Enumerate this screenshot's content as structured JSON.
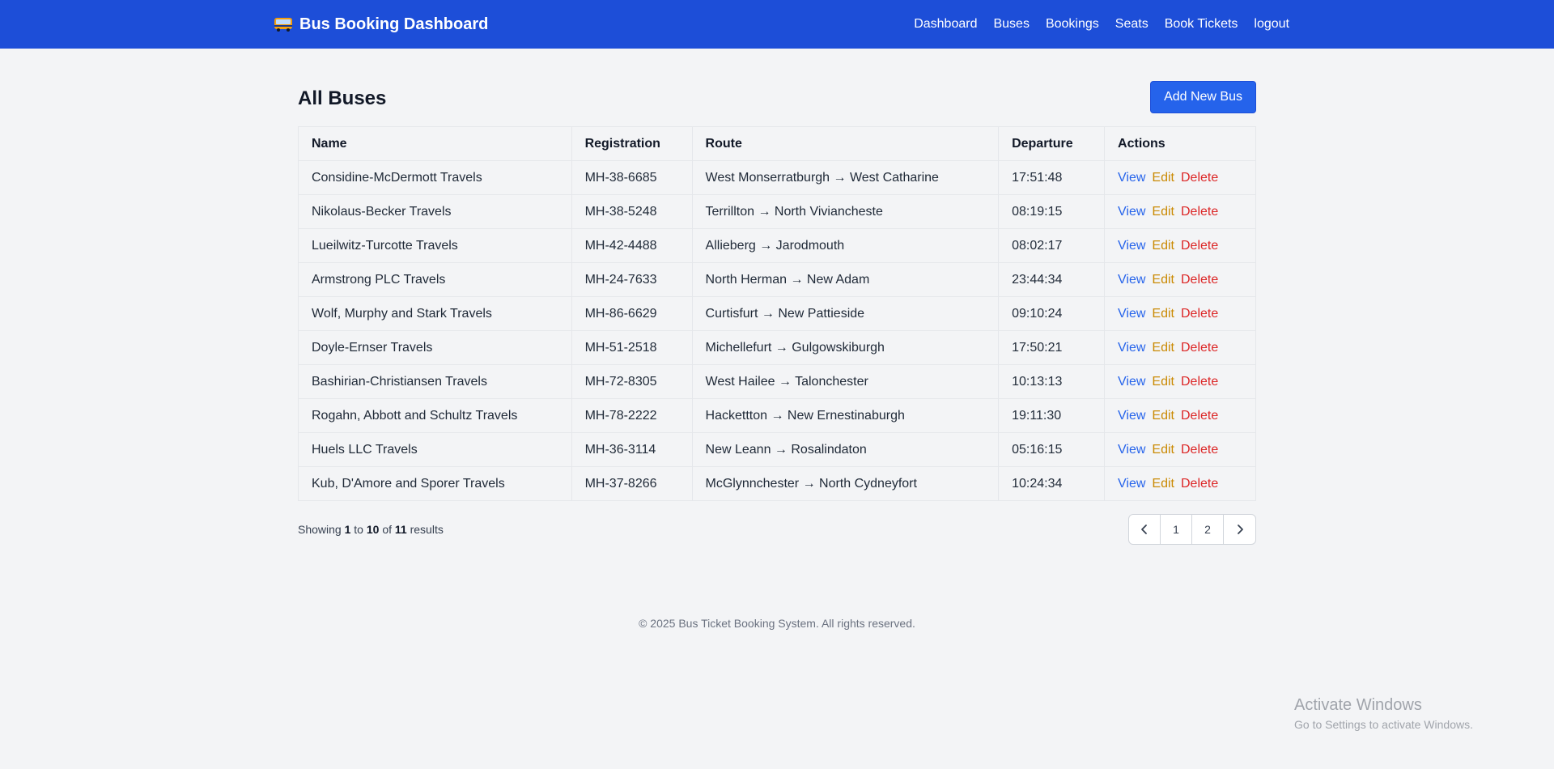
{
  "navbar": {
    "title": "Bus Booking Dashboard",
    "brand_icon": "bus-icon",
    "links": [
      "Dashboard",
      "Buses",
      "Bookings",
      "Seats",
      "Book Tickets",
      "logout"
    ]
  },
  "page": {
    "title": "All Buses",
    "add_button": "Add New Bus"
  },
  "table": {
    "headers": [
      "Name",
      "Registration",
      "Route",
      "Departure",
      "Actions"
    ],
    "rows": [
      {
        "name": "Considine-McDermott Travels",
        "registration": "MH-38-6685",
        "route": "West Monserratburgh → West Catharine",
        "departure": "17:51:48"
      },
      {
        "name": "Nikolaus-Becker Travels",
        "registration": "MH-38-5248",
        "route": "Terrillton → North Viviancheste",
        "departure": "08:19:15"
      },
      {
        "name": "Lueilwitz-Turcotte Travels",
        "registration": "MH-42-4488",
        "route": "Allieberg → Jarodmouth",
        "departure": "08:02:17"
      },
      {
        "name": "Armstrong PLC Travels",
        "registration": "MH-24-7633",
        "route": "North Herman → New Adam",
        "departure": "23:44:34"
      },
      {
        "name": "Wolf, Murphy and Stark Travels",
        "registration": "MH-86-6629",
        "route": "Curtisfurt → New Pattieside",
        "departure": "09:10:24"
      },
      {
        "name": "Doyle-Ernser Travels",
        "registration": "MH-51-2518",
        "route": "Michellefurt → Gulgowskiburgh",
        "departure": "17:50:21"
      },
      {
        "name": "Bashirian-Christiansen Travels",
        "registration": "MH-72-8305",
        "route": "West Hailee → Talonchester",
        "departure": "10:13:13"
      },
      {
        "name": "Rogahn, Abbott and Schultz Travels",
        "registration": "MH-78-2222",
        "route": "Hackettton → New Ernestinaburgh",
        "departure": "19:11:30"
      },
      {
        "name": "Huels LLC Travels",
        "registration": "MH-36-3114",
        "route": "New Leann → Rosalindaton",
        "departure": "05:16:15"
      },
      {
        "name": "Kub, D'Amore and Sporer Travels",
        "registration": "MH-37-8266",
        "route": "McGlynnchester → North Cydneyfort",
        "departure": "10:24:34"
      }
    ],
    "actions": {
      "view": "View",
      "edit": "Edit",
      "delete": "Delete"
    }
  },
  "pagination": {
    "showing_prefix": "Showing",
    "from": "1",
    "to_word": "to",
    "to": "10",
    "of_word": "of",
    "total": "11",
    "suffix": "results",
    "pages": [
      "1",
      "2"
    ],
    "prev_icon": "chevron-left-icon",
    "next_icon": "chevron-right-icon"
  },
  "footer": {
    "copyright": "© 2025 Bus Ticket Booking System. All rights reserved."
  },
  "watermark": {
    "title": "Activate Windows",
    "subtitle": "Go to Settings to activate Windows."
  },
  "colors": {
    "navbar": "#1d4ed8",
    "primary_button": "#2563eb",
    "view": "#2563eb",
    "edit": "#ca8a04",
    "delete": "#dc2626",
    "background": "#f3f4f6"
  }
}
